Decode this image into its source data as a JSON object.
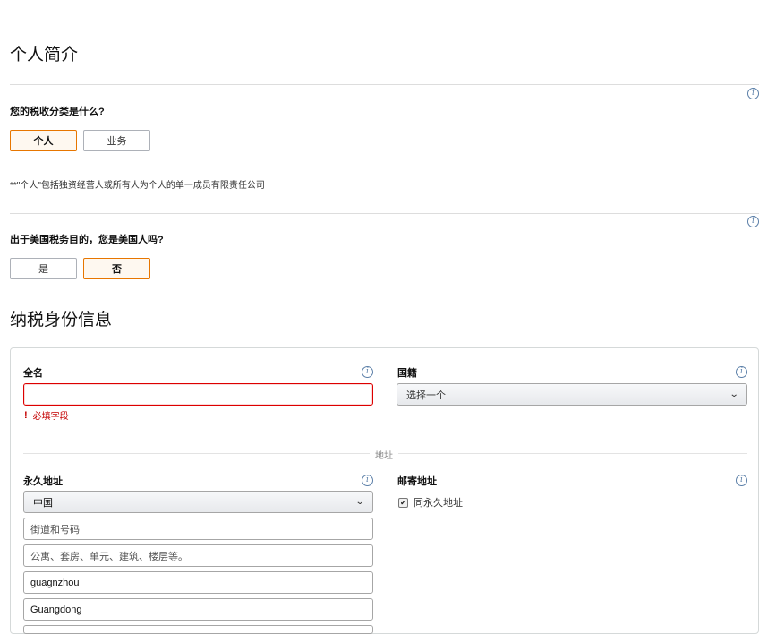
{
  "profile": {
    "title": "个人简介",
    "tax_question": "您的税收分类是什么?",
    "tax_options": [
      "个人",
      "业务"
    ],
    "tax_selected": "个人",
    "note": "**\"个人\"包括独资经营人或所有人为个人的单一成员有限责任公司",
    "us_question": "出于美国税务目的，您是美国人吗?",
    "us_options": [
      "是",
      "否"
    ],
    "us_selected": "否"
  },
  "tax_identity": {
    "title": "纳税身份信息",
    "full_name": {
      "label": "全名",
      "value": "",
      "error": "必填字段"
    },
    "nationality": {
      "label": "国籍",
      "selected": "选择一个"
    },
    "address_divider": "地址",
    "permanent_address": {
      "label": "永久地址",
      "country": "中国",
      "street_placeholder": "街道和号码",
      "line2_placeholder": "公寓、套房、单元、建筑、楼层等。",
      "city": "guagnzhou",
      "province": "Guangdong"
    },
    "mailing_address": {
      "label": "邮寄地址",
      "same_as_permanent_label": "同永久地址",
      "same_as_permanent_checked": true
    }
  },
  "icons": {
    "info": "info-icon",
    "dropdown": "chevron-down-icon",
    "error": "exclamation-icon",
    "checkbox": "checkbox-icon"
  },
  "colors": {
    "selected_border": "#e77600",
    "selected_bg": "#fef8f0",
    "error": "#c40000",
    "info": "#5b7fa8"
  }
}
